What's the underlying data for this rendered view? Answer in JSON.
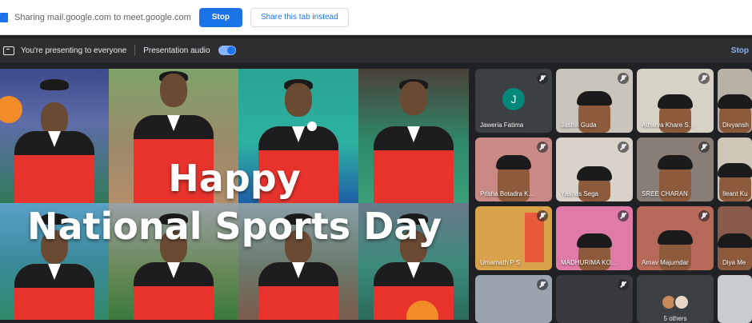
{
  "share_bar": {
    "message": "Sharing mail.google.com to meet.google.com",
    "stop_label": "Stop",
    "share_tab_label": "Share this tab instead"
  },
  "present_bar": {
    "presenting_text": "You're presenting to everyone",
    "audio_label": "Presentation audio",
    "audio_enabled": true,
    "stop_label": "Stop"
  },
  "presentation": {
    "line1": "Happy",
    "line2": "National Sports Day"
  },
  "participants": [
    {
      "name": "Jaweria Fatima",
      "initial": "J"
    },
    {
      "name": "Jashvi Guda"
    },
    {
      "name": "Atharva Khare S..."
    },
    {
      "name": "Divyansh"
    },
    {
      "name": "Prisha Botadra K..."
    },
    {
      "name": "Yashas Sega"
    },
    {
      "name": "SREE CHARAN"
    },
    {
      "name": "Ileant Ku"
    },
    {
      "name": "Umarnath P S"
    },
    {
      "name": "MADHURIMA KO..."
    },
    {
      "name": "Arnav Majumdar"
    },
    {
      "name": "Diya Me"
    }
  ],
  "others": {
    "label": "5 others"
  },
  "colors": {
    "accent": "#1a73e8",
    "meet_bg": "#202124",
    "jersey_red": "#e8332c",
    "avatar_teal": "#00897b"
  }
}
